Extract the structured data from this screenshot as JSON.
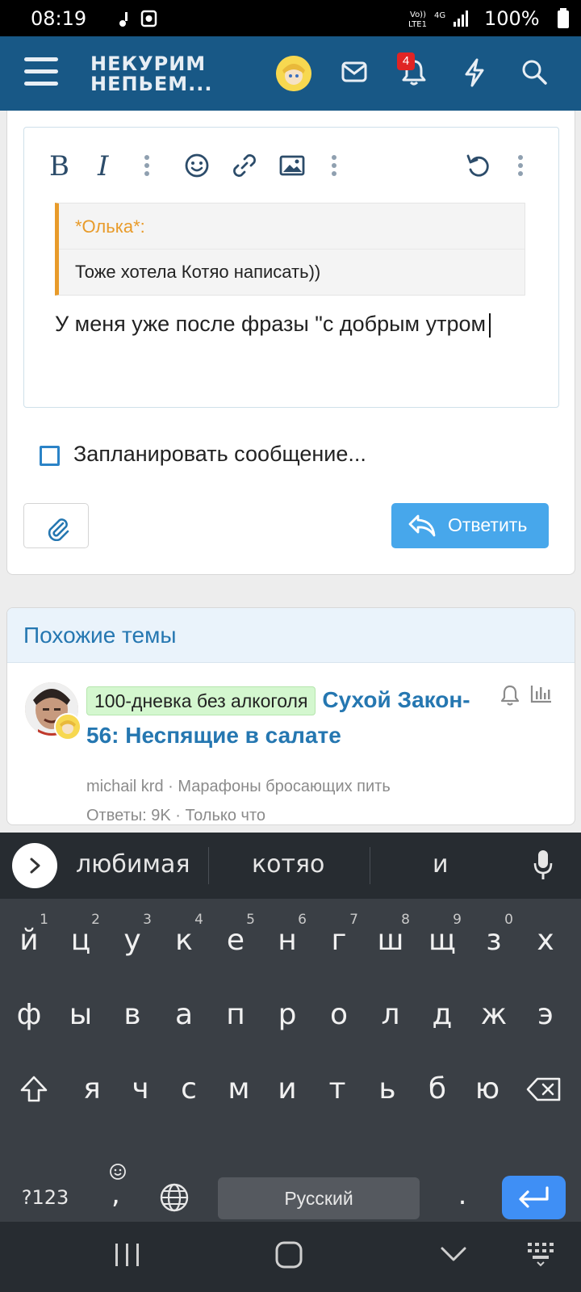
{
  "status_bar": {
    "time": "08:19",
    "battery": "100%",
    "network": "Vo) LTE1 4G"
  },
  "header": {
    "logo_line1": "НЕКУРИМ",
    "logo_line2": "НЕПЬЕМ...",
    "notification_count": "4"
  },
  "editor": {
    "quote_author": "*Олька*:",
    "quote_text": "Тоже хотела Котяо написать))",
    "body_text": "У меня уже после фразы \"с добрым утром"
  },
  "schedule_label": "Запланировать сообщение...",
  "reply_label": "Ответить",
  "similar": {
    "title": "Похожие темы",
    "thread": {
      "prefix": "100-дневка без алкоголя",
      "title": "Сухой Закон- 56: Неспящие в салате",
      "author_forum": "michail krd · Марафоны бросающих пить",
      "stats": "Ответы: 9K · Только что"
    }
  },
  "keyboard": {
    "suggestions": [
      "любимая",
      "котяо",
      "и"
    ],
    "row1": [
      {
        "k": "й",
        "n": "1"
      },
      {
        "k": "ц",
        "n": "2"
      },
      {
        "k": "у",
        "n": "3"
      },
      {
        "k": "к",
        "n": "4"
      },
      {
        "k": "е",
        "n": "5"
      },
      {
        "k": "н",
        "n": "6"
      },
      {
        "k": "г",
        "n": "7"
      },
      {
        "k": "ш",
        "n": "8"
      },
      {
        "k": "щ",
        "n": "9"
      },
      {
        "k": "з",
        "n": "0"
      },
      {
        "k": "х",
        "n": ""
      }
    ],
    "row2": [
      "ф",
      "ы",
      "в",
      "а",
      "п",
      "р",
      "о",
      "л",
      "д",
      "ж",
      "э"
    ],
    "row3": [
      "я",
      "ч",
      "с",
      "м",
      "и",
      "т",
      "ь",
      "б",
      "ю"
    ],
    "symbols_key": "?123",
    "comma_key": ",",
    "space_label": "Русский",
    "period_key": "."
  },
  "colors": {
    "header": "#185886",
    "accent": "#2577b1",
    "reply_button": "#47a7eb",
    "quote_bar": "#e89b2a",
    "prefix_bg": "#d4f7cf",
    "badge": "#e02424"
  }
}
